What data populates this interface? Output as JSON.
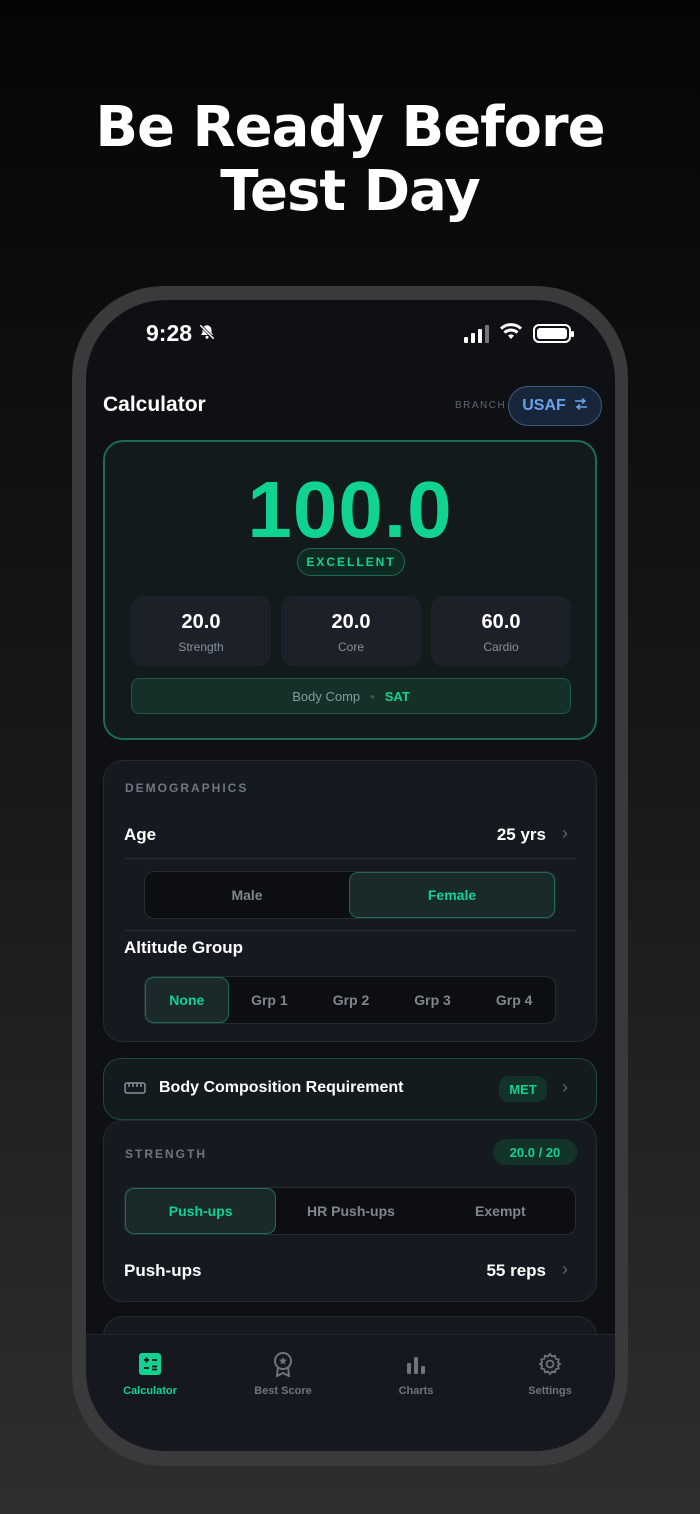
{
  "headline": {
    "line1": "Be Ready Before",
    "line2": "Test Day"
  },
  "status_bar": {
    "time": "9:28"
  },
  "header": {
    "title": "Calculator",
    "branch_label": "BRANCH",
    "branch_value": "USAF"
  },
  "score": {
    "total": "100.0",
    "rating": "EXCELLENT",
    "components": [
      {
        "value": "20.0",
        "label": "Strength"
      },
      {
        "value": "20.0",
        "label": "Core"
      },
      {
        "value": "60.0",
        "label": "Cardio"
      }
    ],
    "body_comp_label": "Body Comp",
    "body_comp_separator": "•",
    "body_comp_value": "SAT"
  },
  "demographics": {
    "section_label": "DEMOGRAPHICS",
    "age_label": "Age",
    "age_value": "25 yrs",
    "gender_options": [
      "Male",
      "Female"
    ],
    "gender_selected": "Female",
    "altitude_label": "Altitude Group",
    "altitude_options": [
      "None",
      "Grp 1",
      "Grp 2",
      "Grp 3",
      "Grp 4"
    ],
    "altitude_selected": "None"
  },
  "body_composition": {
    "label": "Body Composition Requirement",
    "status": "MET"
  },
  "strength": {
    "section_label": "STRENGTH",
    "score": "20.0 / 20",
    "options": [
      "Push-ups",
      "HR Push-ups",
      "Exempt"
    ],
    "selected": "Push-ups",
    "row_label": "Push-ups",
    "row_value": "55 reps"
  },
  "tabbar": {
    "tabs": [
      {
        "label": "Calculator",
        "icon": "calculator-icon",
        "active": true
      },
      {
        "label": "Best Score",
        "icon": "award-icon",
        "active": false
      },
      {
        "label": "Charts",
        "icon": "bar-chart-icon",
        "active": false
      },
      {
        "label": "Settings",
        "icon": "gear-icon",
        "active": false
      }
    ]
  },
  "colors": {
    "accent": "#10d391",
    "branch": "#6aa3ea",
    "background": "#0e1013"
  }
}
